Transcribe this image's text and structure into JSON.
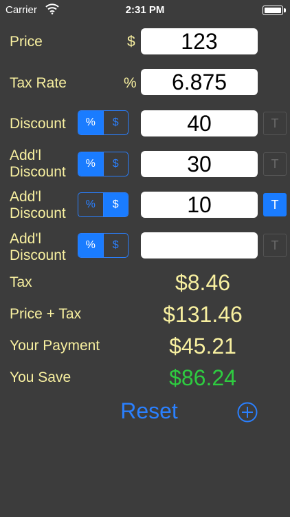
{
  "status_bar": {
    "carrier": "Carrier",
    "time": "2:31 PM"
  },
  "rows": {
    "price": {
      "label": "Price",
      "unit": "$",
      "value": "123"
    },
    "tax_rate": {
      "label": "Tax Rate",
      "unit": "%",
      "value": "6.875"
    },
    "discount1": {
      "label": "Discount",
      "mode_percent": "%",
      "mode_dollar": "$",
      "value": "40",
      "toggle": "T"
    },
    "discount2": {
      "label_line1": "Add'l",
      "label_line2": "Discount",
      "mode_percent": "%",
      "mode_dollar": "$",
      "value": "30",
      "toggle": "T"
    },
    "discount3": {
      "label_line1": "Add'l",
      "label_line2": "Discount",
      "mode_percent": "%",
      "mode_dollar": "$",
      "value": "10",
      "toggle": "T"
    },
    "discount4": {
      "label_line1": "Add'l",
      "label_line2": "Discount",
      "mode_percent": "%",
      "mode_dollar": "$",
      "value": "",
      "toggle": "T"
    }
  },
  "results": {
    "tax": {
      "label": "Tax",
      "value": "$8.46"
    },
    "price_plus_tax": {
      "label": "Price + Tax",
      "value": "$131.46"
    },
    "your_payment": {
      "label": "Your Payment",
      "value": "$45.21"
    },
    "you_save": {
      "label": "You Save",
      "value": "$86.24"
    }
  },
  "actions": {
    "reset": "Reset",
    "add_icon": "plus-circle-icon"
  },
  "colors": {
    "background": "#3c3c3c",
    "label": "#f8f0a0",
    "accent": "#1a7cff",
    "savings": "#2ecc40"
  }
}
